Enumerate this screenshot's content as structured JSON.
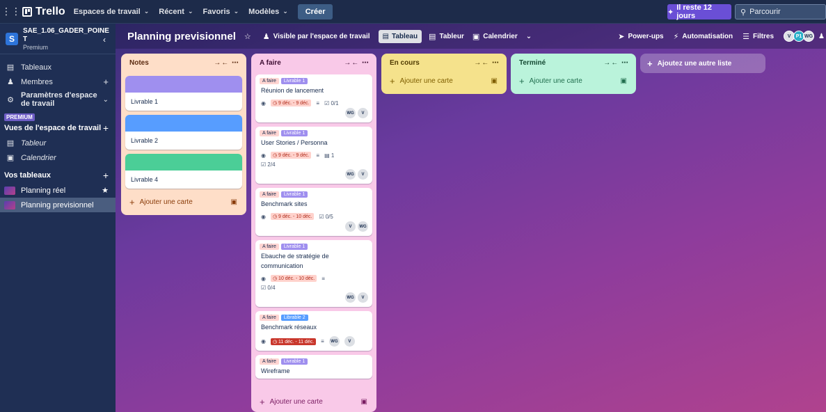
{
  "topbar": {
    "logo": "Trello",
    "nav": [
      "Espaces de travail",
      "Récent",
      "Favoris",
      "Modèles"
    ],
    "create": "Créer",
    "trial": "Il reste 12 jours",
    "search_placeholder": "Parcourir"
  },
  "sidebar": {
    "workspace_avatar": "S",
    "workspace_name": "SAE_1.06_GADER_POINE T",
    "workspace_plan": "Premium",
    "items": [
      {
        "label": "Tableaux"
      },
      {
        "label": "Membres"
      },
      {
        "label": "Paramètres d'espace de travail"
      }
    ],
    "premium_badge": "PREMIUM",
    "views_title": "Vues de l'espace de travail",
    "views": [
      {
        "label": "Tableur"
      },
      {
        "label": "Calendrier"
      }
    ],
    "boards_title": "Vos tableaux",
    "boards": [
      {
        "label": "Planning réel"
      },
      {
        "label": "Planning previsionnel"
      }
    ]
  },
  "board": {
    "title": "Planning previsionnel",
    "visibility": "Visible par l'espace de travail",
    "views": [
      "Tableau",
      "Tableur",
      "Calendrier"
    ],
    "right": [
      "Power-ups",
      "Automatisation",
      "Filtres"
    ],
    "members": [
      {
        "initials": "V",
        "color": "#dfe1e6"
      },
      {
        "initials": "P1",
        "color": "#2ab0c9"
      },
      {
        "initials": "WG",
        "color": "#dfe1e6"
      }
    ],
    "add_list": "Ajoutez une autre liste"
  },
  "lists": {
    "notes": {
      "title": "Notes",
      "add": "Ajouter une carte",
      "cards": [
        {
          "title": "Livrable 1",
          "cover": "#9f8fef"
        },
        {
          "title": "Livrable 2",
          "cover": "#579dff"
        },
        {
          "title": "Livrable 4",
          "cover": "#4bce97"
        }
      ]
    },
    "afaire": {
      "title": "A faire",
      "add": "Ajouter une carte",
      "cards": [
        {
          "l1": "A faire",
          "l2": "Livrable 1",
          "title": "Réunion de lancement",
          "due": "9 déc. - 9 déc.",
          "check": "0/1",
          "m1": "WG",
          "m2": "V"
        },
        {
          "l1": "A faire",
          "l2": "Livrable 1",
          "title": "User Stories / Personna",
          "due": "9 déc. - 9 déc.",
          "att": "1",
          "check": "2/4",
          "m1": "WG",
          "m2": "V"
        },
        {
          "l1": "A faire",
          "l2": "Livrable 1",
          "title": "Benchmark sites",
          "due": "9 déc. - 10 déc.",
          "check": "0/5",
          "m1": "V",
          "m2": "WG"
        },
        {
          "l1": "A faire",
          "l2": "Livrable 1",
          "title": "Ebauche de stratégie de communication",
          "due": "10 déc. - 10 déc.",
          "check": "0/4",
          "m1": "WG",
          "m2": "V"
        },
        {
          "l1": "A faire",
          "l2": "Librable 2",
          "title": "Benchmark réseaux",
          "due": "11 déc. - 11 déc.",
          "m1": "WG",
          "m2": "V"
        },
        {
          "l1": "A faire",
          "l2": "Livrable 1",
          "title": "Wireframe"
        }
      ]
    },
    "encours": {
      "title": "En cours",
      "add": "Ajouter une carte"
    },
    "termine": {
      "title": "Terminé",
      "add": "Ajouter une carte"
    }
  },
  "colors": {
    "label_afaire": "#ffd5d2",
    "label_livrable": "#9f8fef",
    "label_livrable2": "#579dff"
  }
}
